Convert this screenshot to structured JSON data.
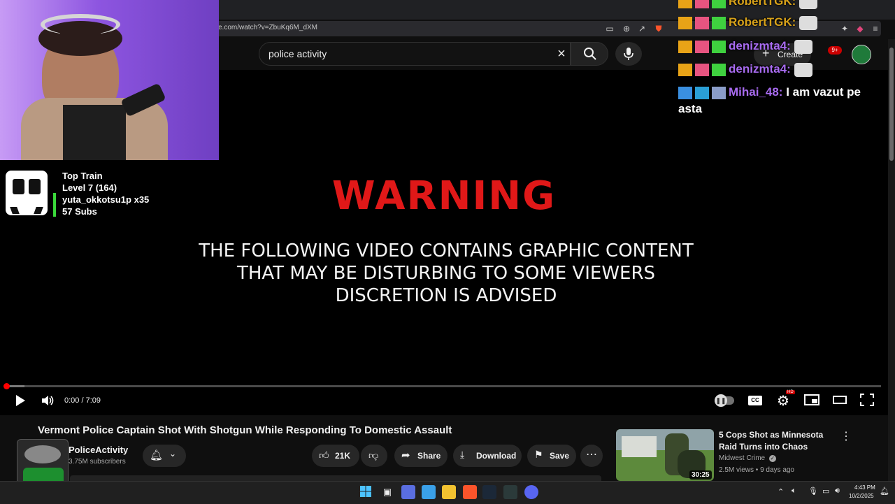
{
  "browser": {
    "url": "e.com/watch?v=ZbuKq6M_dXM"
  },
  "header": {
    "search_value": "police activity",
    "create_label": "Create",
    "notification_count": "9+"
  },
  "video": {
    "warning_title": "WARNING",
    "warning_lines": [
      "THE FOLLOWING VIDEO CONTAINS GRAPHIC CONTENT",
      "THAT MAY BE DISTURBING TO SOME VIEWERS",
      "DISCRETION IS ADVISED"
    ],
    "time": "0:00 / 7:09",
    "progress_fraction": 0.02,
    "hd_badge": "HD"
  },
  "meta": {
    "title": "Vermont Police Captain Shot With Shotgun While Responding To Domestic Assault",
    "channel_name": "PoliceActivity",
    "subscribers": "3.75M subscribers",
    "likes": "21K",
    "share_label": "Share",
    "download_label": "Download",
    "save_label": "Save"
  },
  "suggestion": {
    "title": "5 Cops Shot as Minnesota Raid Turns into Chaos",
    "channel": "Midwest Crime",
    "meta": "2.5M views • 9 days ago",
    "duration": "30:25"
  },
  "overlay": {
    "train_title": "Top Train",
    "train_level": "Level 7  (164)",
    "train_top": "yuta_okkotsu1p x35",
    "train_subs": "57 Subs",
    "chat": [
      {
        "user": "RobertTGK:",
        "color": "#d8a21a",
        "message": ""
      },
      {
        "user": "RobertTGK:",
        "color": "#d8a21a",
        "message": ""
      },
      {
        "user": "denizmta4:",
        "color": "#a86bf0",
        "message": ""
      },
      {
        "user": "denizmta4:",
        "color": "#a86bf0",
        "message": ""
      },
      {
        "user": "Mihai_48:",
        "color": "#a86bf0",
        "message": "I am vazut pe"
      },
      {
        "user": "",
        "color": "#ffffff",
        "message": "asta"
      }
    ]
  },
  "taskbar": {
    "time": "4:43 PM",
    "date": "10/2/2025"
  },
  "colors": {
    "accent_red": "#ff0000",
    "warning_red": "#e01818",
    "background": "#0f0f0f"
  }
}
